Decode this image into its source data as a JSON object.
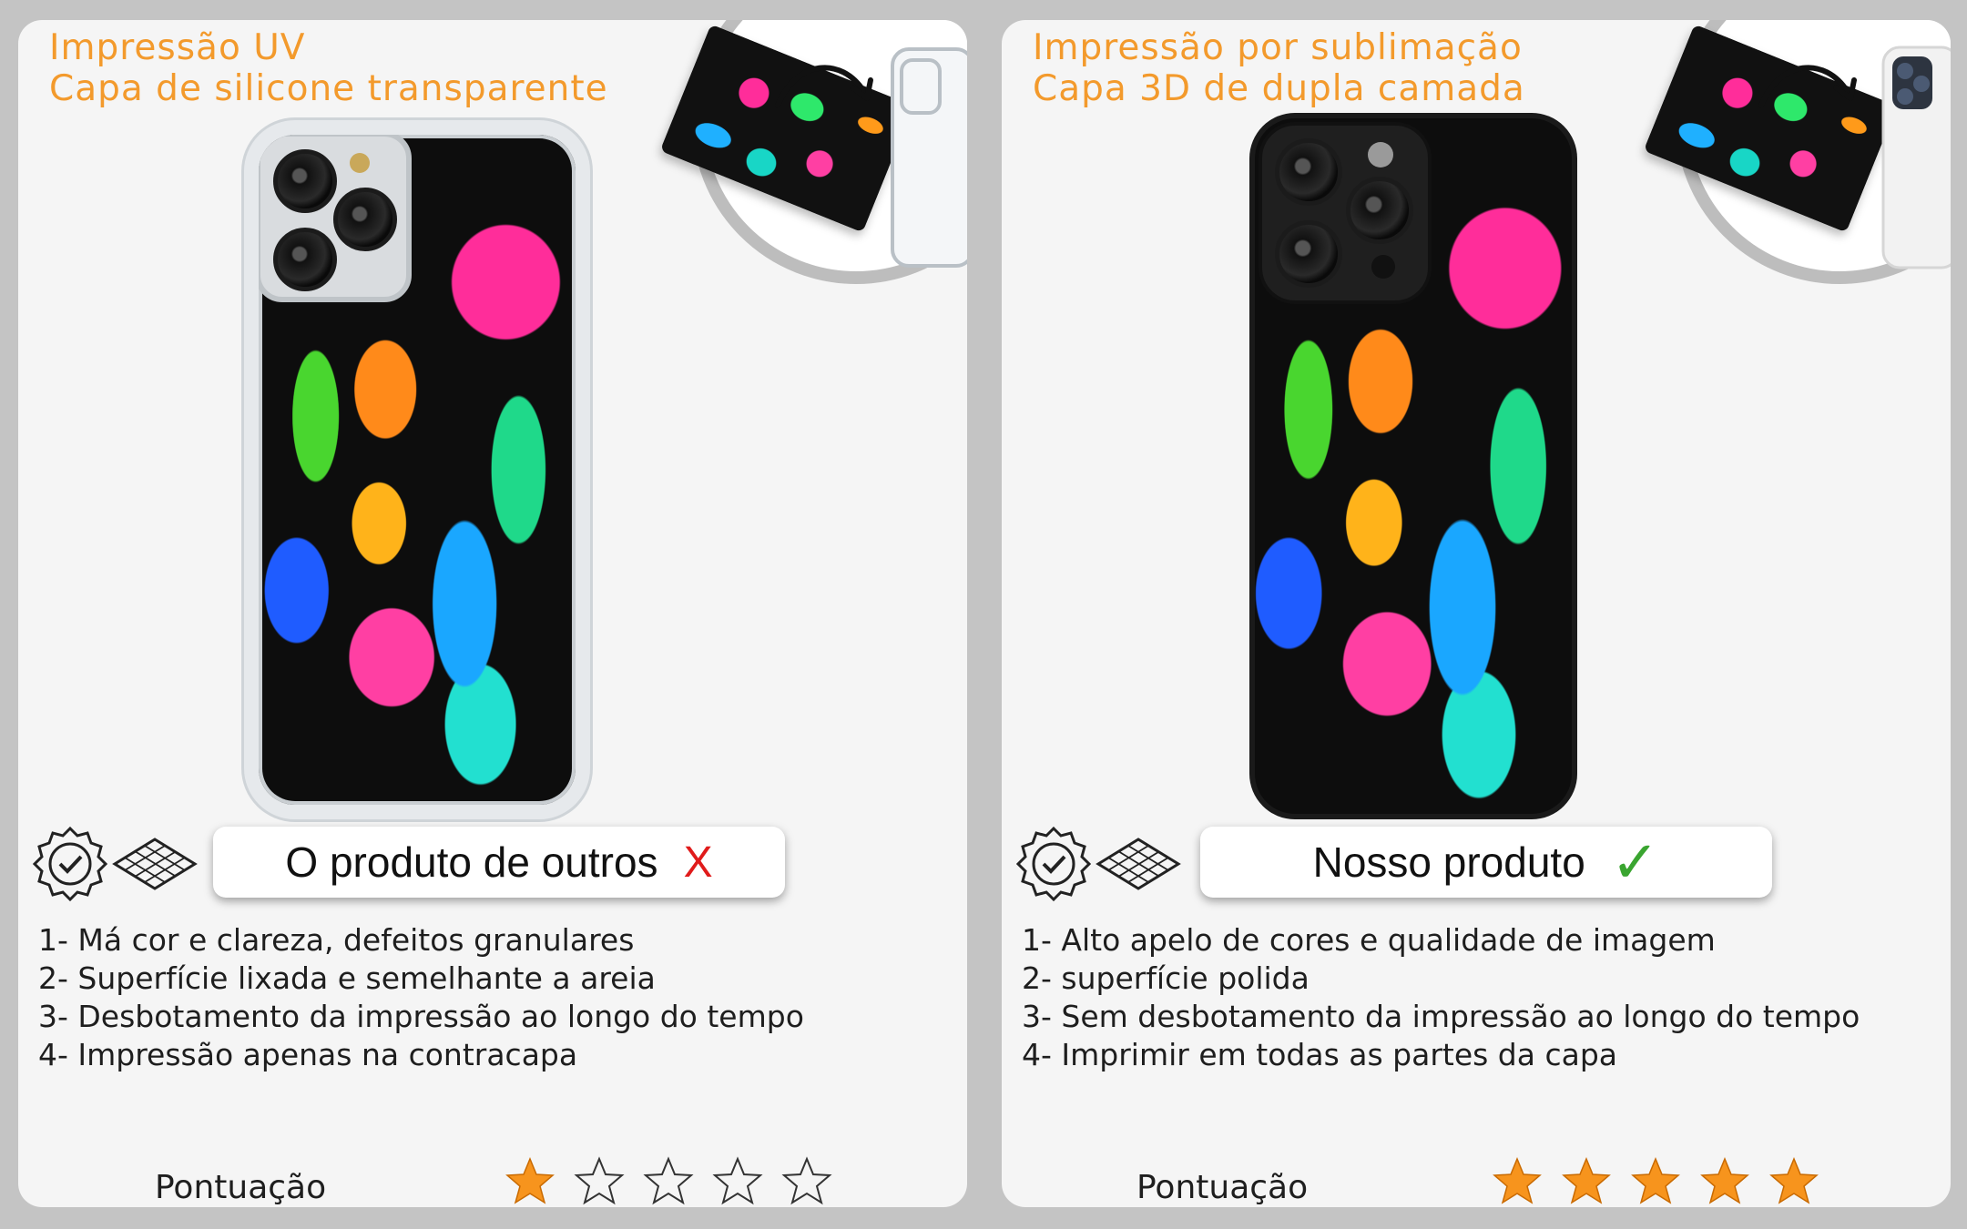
{
  "colors": {
    "heading": "#f39a2c",
    "panel_bg": "#f5f5f5",
    "page_bg": "#c4c4c4",
    "bad_mark": "#e01b1b",
    "good_mark": "#3aa530",
    "star_filled": "#f7941d"
  },
  "left": {
    "heading_line1": "Impressão UV",
    "heading_line2": "Capa de silicone transparente",
    "label": "O produto de outros",
    "mark": "X",
    "features": [
      "1- Má cor e clareza, defeitos granulares",
      "2- Superfície lixada e semelhante a areia",
      "3- Desbotamento da impressão ao longo do tempo",
      "4- Impressão apenas na contracapa"
    ],
    "score_label": "Pontuação",
    "rating": 1,
    "rating_max": 5
  },
  "right": {
    "heading_line1": "Impressão por sublimação",
    "heading_line2": "Capa 3D de dupla camada",
    "label": "Nosso produto",
    "mark": "✓",
    "features": [
      "1- Alto apelo de cores e qualidade de imagem",
      "2- superfície polida",
      "3- Sem desbotamento da impressão ao longo do tempo",
      "4- Imprimir em todas as partes da capa"
    ],
    "score_label": "Pontuação",
    "rating": 5,
    "rating_max": 5
  },
  "icons": {
    "badge": "verified-badge-icon",
    "texture": "surface-mesh-icon",
    "star": "star-icon",
    "arrow": "curved-arrow-icon"
  }
}
